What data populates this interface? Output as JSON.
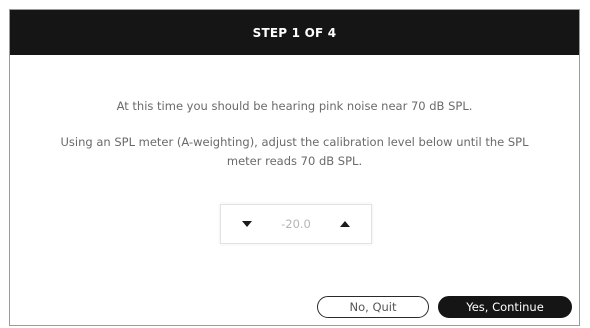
{
  "dialog": {
    "title": "STEP 1 OF 4",
    "message_line1": "At this time you should be hearing pink noise near 70 dB SPL.",
    "message_line2": "Using an SPL meter (A-weighting), adjust the calibration level below until the SPL meter reads 70 dB SPL."
  },
  "stepper": {
    "value": "-20.0",
    "decrement_icon": "triangle-down-icon",
    "increment_icon": "triangle-up-icon"
  },
  "buttons": {
    "quit_label": "No, Quit",
    "continue_label": "Yes, Continue"
  },
  "colors": {
    "title_bar": "#151515",
    "body_text": "#6a6a6a",
    "stepper_value": "#b5b5b5",
    "primary_button": "#151515"
  }
}
